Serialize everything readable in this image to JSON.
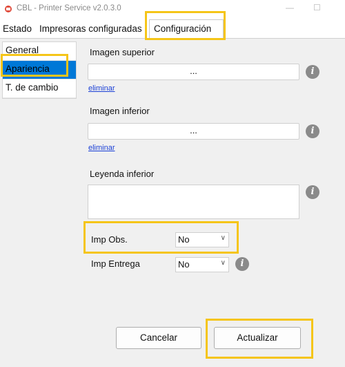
{
  "window": {
    "title": "CBL - Printer Service v2.0.3.0"
  },
  "tabs": [
    {
      "label": "Estado"
    },
    {
      "label": "Impresoras configuradas"
    },
    {
      "label": "Configuración"
    }
  ],
  "sidebar": {
    "items": [
      {
        "label": "General"
      },
      {
        "label": "Apariencia"
      },
      {
        "label": "T. de cambio"
      }
    ]
  },
  "form": {
    "imagen_superior": {
      "label": "Imagen superior",
      "button": "...",
      "remove": "eliminar"
    },
    "imagen_inferior": {
      "label": "Imagen inferior",
      "button": "...",
      "remove": "eliminar"
    },
    "leyenda_inferior": {
      "label": "Leyenda inferior",
      "value": ""
    },
    "imp_obs": {
      "label": "Imp Obs.",
      "value": "No"
    },
    "imp_entrega": {
      "label": "Imp Entrega",
      "value": "No"
    },
    "info_glyph": "i"
  },
  "buttons": {
    "cancel": "Cancelar",
    "update": "Actualizar"
  },
  "colors": {
    "highlight": "#f5c518",
    "selection": "#0078d7",
    "link": "#1a3fd6"
  }
}
